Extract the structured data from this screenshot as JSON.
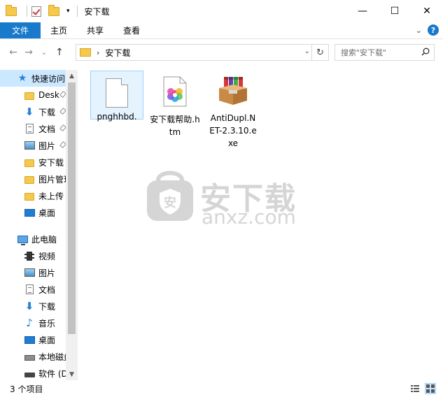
{
  "window": {
    "title": "安下载",
    "minimize": "—",
    "maximize": "☐",
    "close": "✕"
  },
  "ribbon": {
    "tabs": [
      "文件",
      "主页",
      "共享",
      "查看"
    ],
    "help": "?",
    "collapse": "⌄"
  },
  "address": {
    "path": "安下载",
    "search_placeholder": "搜索\"安下载\""
  },
  "sidebar": {
    "quick_access": "快速访问",
    "quick_items": [
      "Desktop",
      "下载",
      "文档",
      "图片",
      "安下载",
      "图片管理",
      "未上传",
      "桌面"
    ],
    "this_pc": "此电脑",
    "pc_items": [
      "视频",
      "图片",
      "文档",
      "下载",
      "音乐",
      "桌面",
      "本地磁盘",
      "软件 (D:)"
    ]
  },
  "files": [
    {
      "name": "pnghhbd.",
      "selected": true
    },
    {
      "name": "安下载帮助.htm",
      "selected": false
    },
    {
      "name": "AntiDupl.NET-2.3.10.exe",
      "selected": false
    }
  ],
  "watermark": {
    "title": "安下载",
    "domain": "anxz.com"
  },
  "status": {
    "count": "3 个项目"
  },
  "colors": {
    "accent": "#1979ca",
    "selection": "#cce8ff",
    "folder": "#f5c94e"
  }
}
